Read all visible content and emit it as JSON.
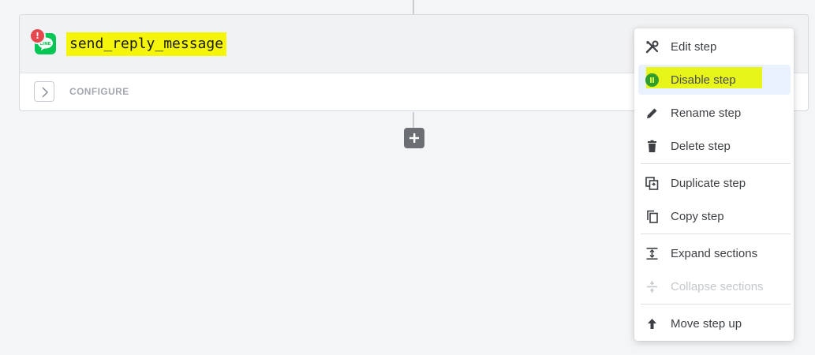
{
  "step": {
    "title": "send_reply_message",
    "error_badge": "!",
    "app_icon": "line-app-icon",
    "configure_label": "CONFIGURE"
  },
  "menu": {
    "items": [
      {
        "label": "Edit step",
        "icon": "tools-icon"
      },
      {
        "label": "Disable step",
        "icon": "pause-icon"
      },
      {
        "label": "Rename step",
        "icon": "pencil-icon"
      },
      {
        "label": "Delete step",
        "icon": "trash-icon"
      },
      {
        "label": "Duplicate step",
        "icon": "duplicate-icon"
      },
      {
        "label": "Copy step",
        "icon": "copy-icon"
      },
      {
        "label": "Expand sections",
        "icon": "expand-icon"
      },
      {
        "label": "Collapse sections",
        "icon": "collapse-icon"
      },
      {
        "label": "Move step up",
        "icon": "arrow-up-icon"
      }
    ]
  },
  "colors": {
    "page_background": "#f4f5f7",
    "highlight": "#f5f50a",
    "line_green": "#06c755",
    "error_red": "#e5484d",
    "menu_hover": "#e9f2fc"
  }
}
